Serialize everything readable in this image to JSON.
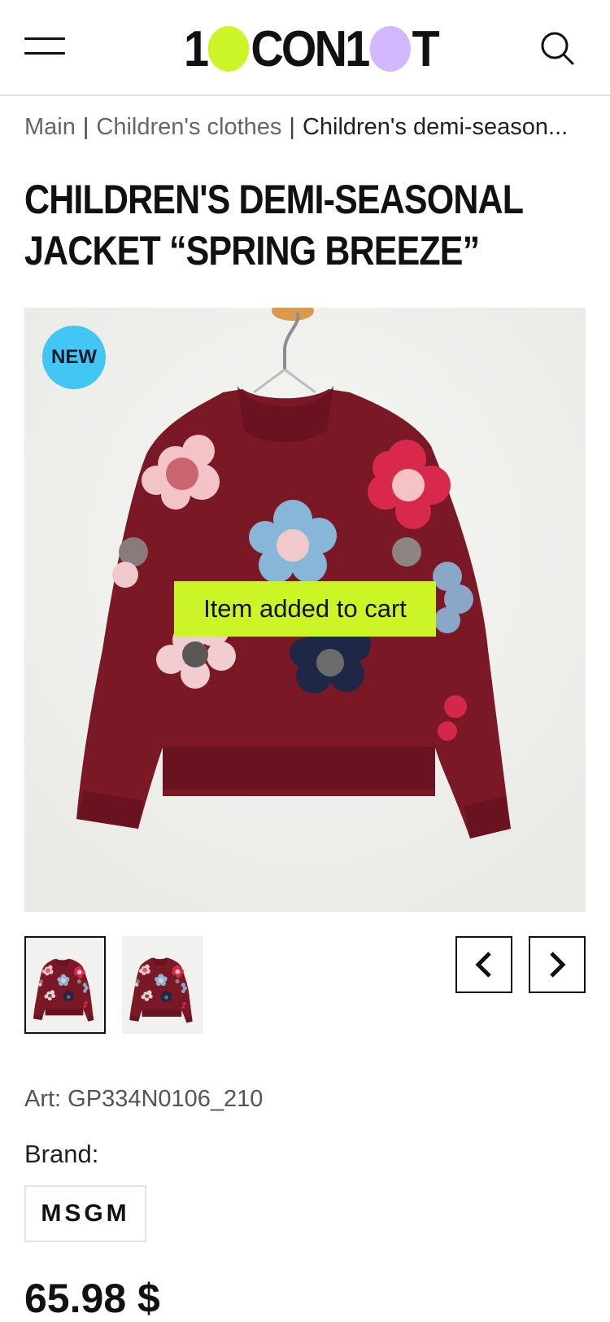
{
  "header": {
    "menu_icon": "hamburger-menu-icon",
    "logo": {
      "text_parts": [
        "1",
        "CON1",
        "T"
      ],
      "dot_colors": [
        "#ccf528",
        "#d3b7ff"
      ]
    },
    "search_icon": "search-icon"
  },
  "breadcrumb": {
    "items": [
      "Main",
      "Children's clothes",
      "Children's demi-season..."
    ],
    "separator": "|"
  },
  "product": {
    "title_line1": "CHILDREN'S DEMI-SEASONAL",
    "title_line2": "JACKET “SPRING BREEZE”",
    "badge": "NEW",
    "badge_color": "#42c6f4",
    "toast": "Item added to cart",
    "toast_color": "#ccf528",
    "sweater_color": "#7a1826",
    "art": "Art: GP334N0106_210",
    "brand_label": "Brand:",
    "brand": "MSGM",
    "price": "65.98 $"
  },
  "gallery": {
    "thumbnails_count": 2,
    "selected_index": 0,
    "prev_icon": "chevron-left-icon",
    "next_icon": "chevron-right-icon"
  }
}
